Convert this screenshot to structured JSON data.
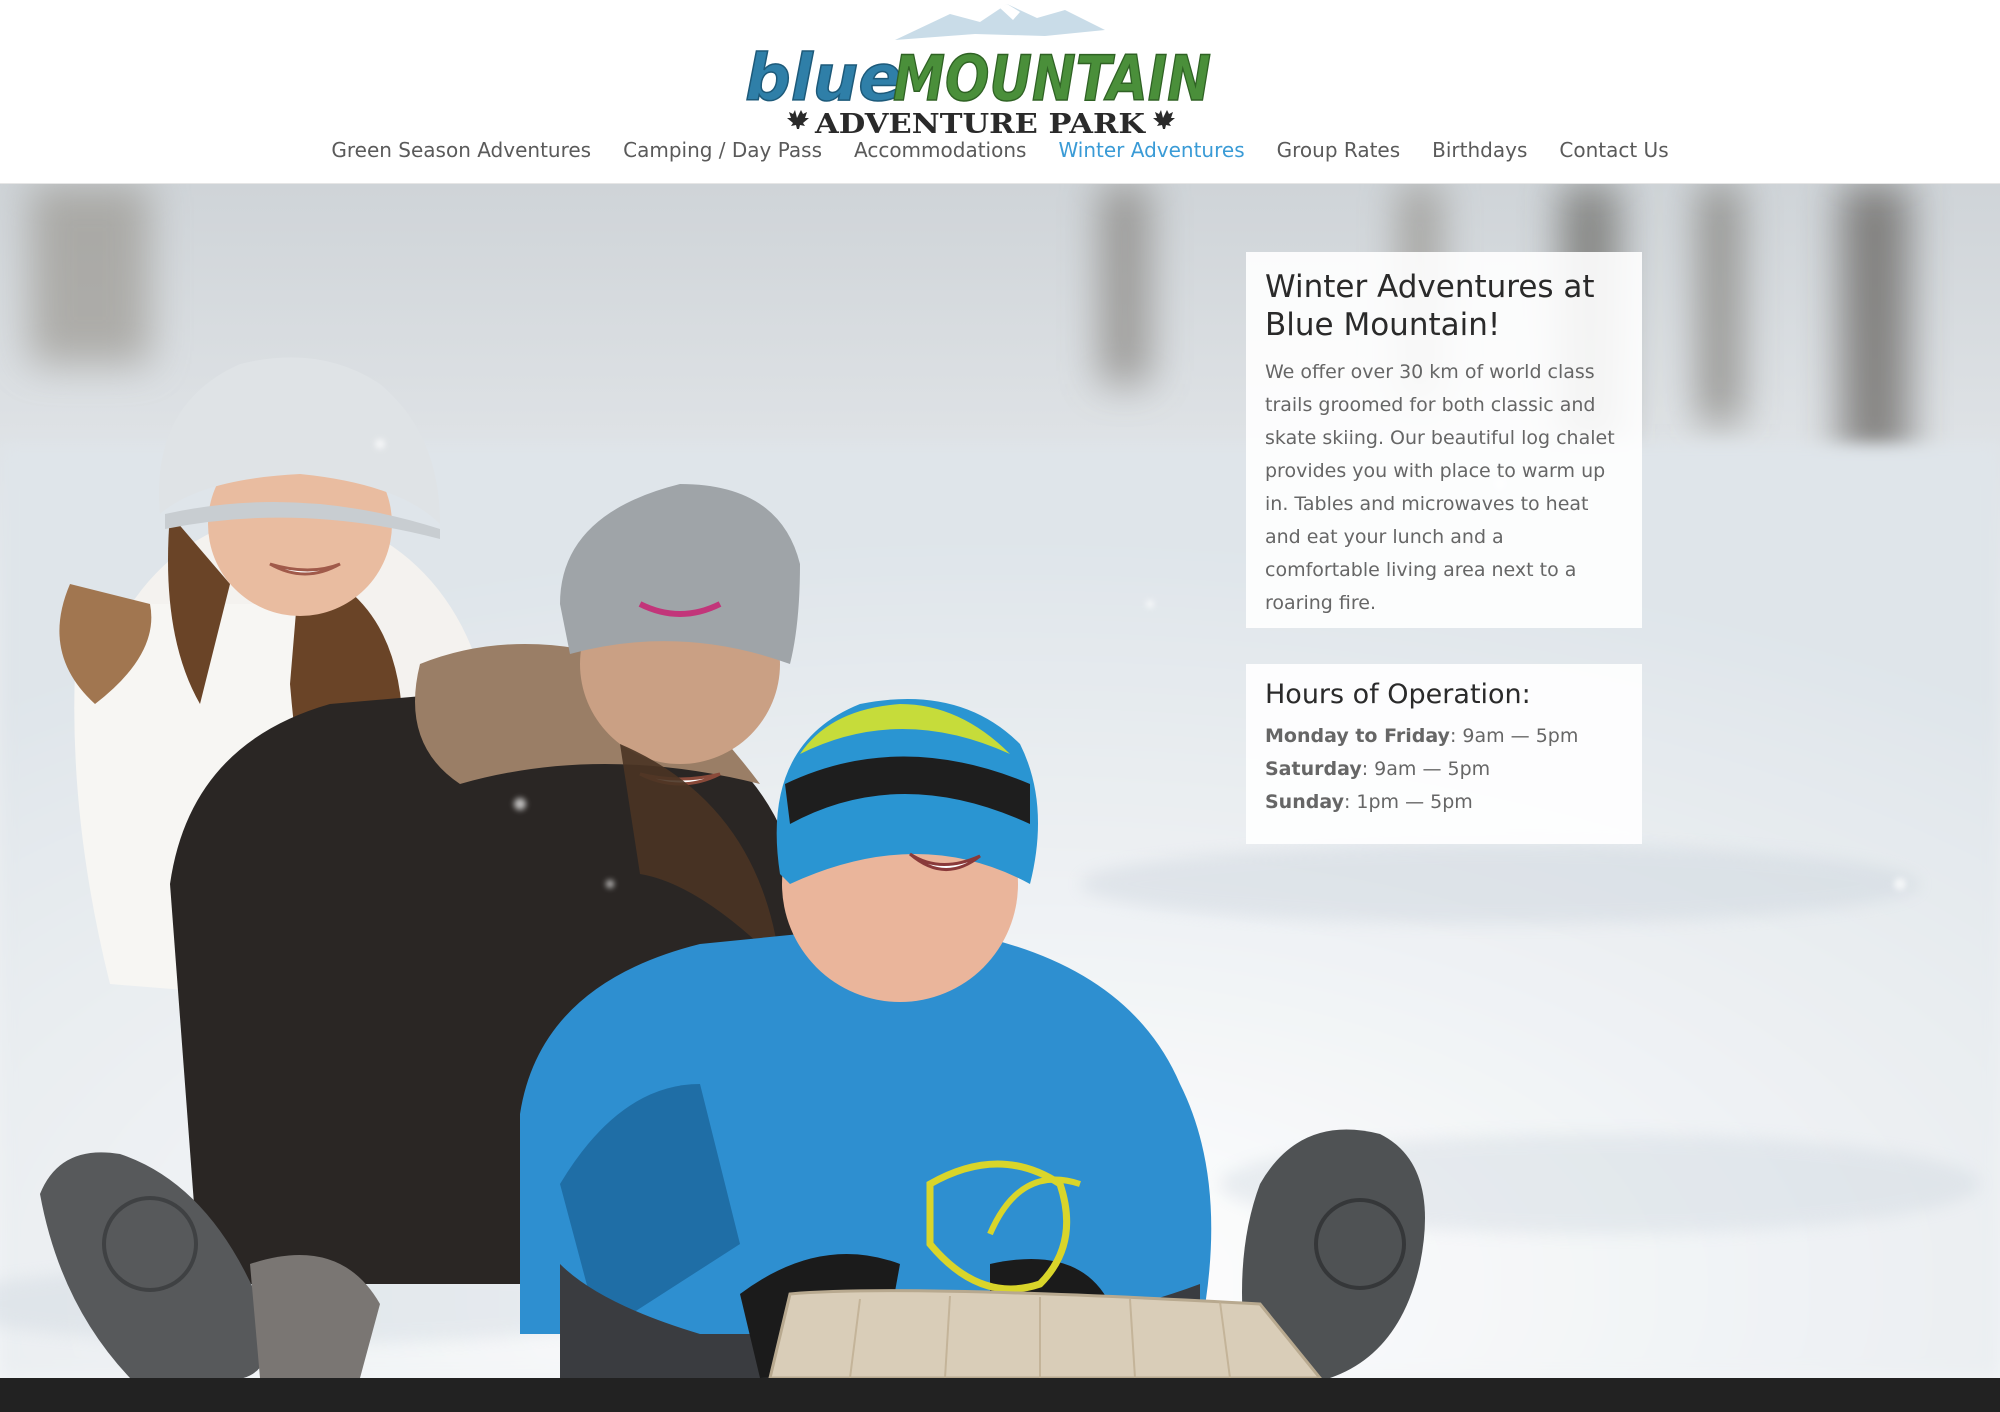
{
  "logo": {
    "word_blue": "blue",
    "word_mountain": "MOUNTAIN",
    "subtitle": "ADVENTURE PARK"
  },
  "nav": {
    "items": [
      {
        "label": "Green Season Adventures"
      },
      {
        "label": "Camping / Day Pass"
      },
      {
        "label": "Accommodations"
      },
      {
        "label": "Winter Adventures"
      },
      {
        "label": "Group Rates"
      },
      {
        "label": "Birthdays"
      },
      {
        "label": "Contact Us"
      }
    ],
    "active_item": "Winter Adventures"
  },
  "hero": {
    "image_icon": "photo-kids-sledding-in-snow"
  },
  "intro": {
    "title": "Winter Adventures at Blue Mountain!",
    "body": "We offer over 30 km of world class trails groomed for both classic and skate skiing. Our beautiful log chalet provides you with place to warm up in. Tables and microwaves to heat and eat your lunch and a comfortable living area next to a roaring fire."
  },
  "hours": {
    "title": "Hours of Operation:",
    "items": [
      {
        "day": "Monday to Friday",
        "time": ": 9am — 5pm"
      },
      {
        "day": "Saturday",
        "time": ": 9am — 5pm"
      },
      {
        "day": "Sunday",
        "time": ": 1pm — 5pm"
      }
    ]
  },
  "colors": {
    "nav_active": "#3a9bd6",
    "nav_text": "#5a5a5a",
    "logo_blue": "#2f7fa8",
    "logo_green": "#4a8f3a",
    "logo_dark": "#2a2a2a",
    "footer": "#222222"
  }
}
